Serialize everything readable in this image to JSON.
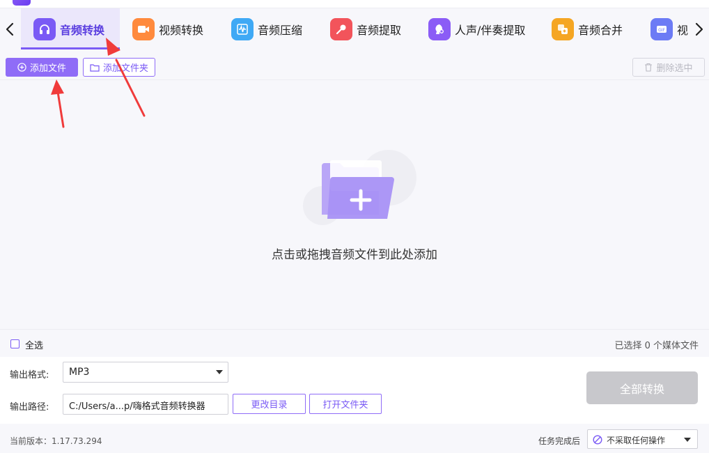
{
  "tabs": [
    {
      "label": "音频转换",
      "active": true,
      "icon": "headphones-icon",
      "color": "#7a5af5"
    },
    {
      "label": "视频转换",
      "active": false,
      "icon": "video-camera-icon",
      "color": "#ff8a3d"
    },
    {
      "label": "音频压缩",
      "active": false,
      "icon": "waveform-icon",
      "color": "#3fa9f5"
    },
    {
      "label": "音频提取",
      "active": false,
      "icon": "microphone-icon",
      "color": "#f2545b"
    },
    {
      "label": "人声/伴奏提取",
      "active": false,
      "icon": "vocal-icon",
      "color": "#8b5cf6"
    },
    {
      "label": "音频合并",
      "active": false,
      "icon": "merge-icon",
      "color": "#f5a623"
    },
    {
      "label": "视",
      "active": false,
      "icon": "gif-icon",
      "color": "#6c7bf5"
    }
  ],
  "toolbar": {
    "add_file": "添加文件",
    "add_folder": "添加文件夹",
    "delete_selected": "删除选中"
  },
  "dropzone": {
    "hint": "点击或拖拽音频文件到此处添加"
  },
  "selection": {
    "select_all": "全选",
    "selected_count": "已选择 0 个媒体文件"
  },
  "settings": {
    "format_label": "输出格式:",
    "format_value": "MP3",
    "path_label": "输出路径:",
    "path_value": "C:/Users/a...p/嗨格式音频转换器",
    "change_dir": "更改目录",
    "open_folder": "打开文件夹",
    "convert_all": "全部转换"
  },
  "status": {
    "version": "当前版本：1.17.73.294",
    "after_label": "任务完成后",
    "after_value": "不采取任何操作"
  },
  "colors": {
    "accent": "#8f6cf7",
    "accent_dark": "#5b3fe0",
    "annotation_red": "#f03b3b",
    "disabled": "#c8c8cc"
  }
}
